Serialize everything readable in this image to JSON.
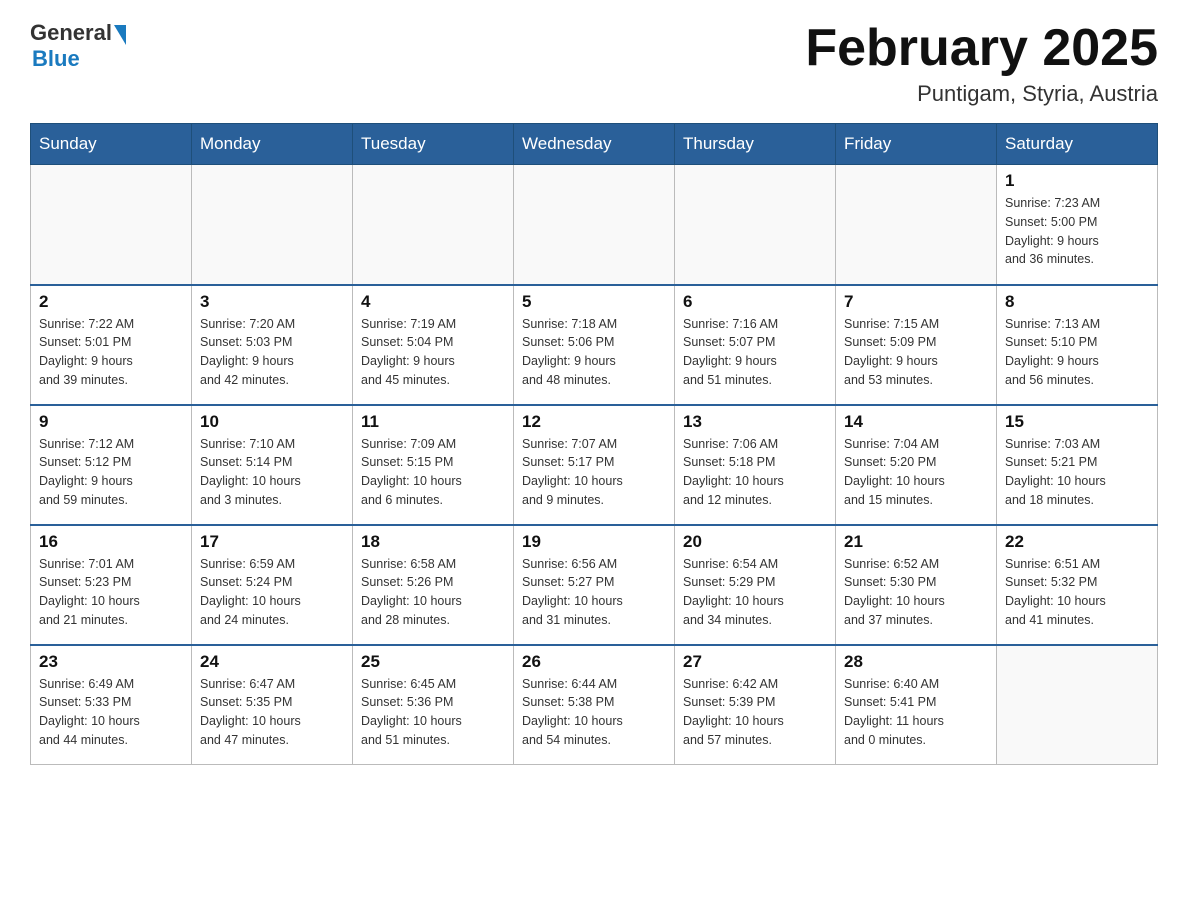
{
  "header": {
    "logo_general": "General",
    "logo_blue": "Blue",
    "month_title": "February 2025",
    "location": "Puntigam, Styria, Austria"
  },
  "days_of_week": [
    "Sunday",
    "Monday",
    "Tuesday",
    "Wednesday",
    "Thursday",
    "Friday",
    "Saturday"
  ],
  "weeks": [
    {
      "days": [
        {
          "date": "",
          "info": ""
        },
        {
          "date": "",
          "info": ""
        },
        {
          "date": "",
          "info": ""
        },
        {
          "date": "",
          "info": ""
        },
        {
          "date": "",
          "info": ""
        },
        {
          "date": "",
          "info": ""
        },
        {
          "date": "1",
          "info": "Sunrise: 7:23 AM\nSunset: 5:00 PM\nDaylight: 9 hours\nand 36 minutes."
        }
      ]
    },
    {
      "days": [
        {
          "date": "2",
          "info": "Sunrise: 7:22 AM\nSunset: 5:01 PM\nDaylight: 9 hours\nand 39 minutes."
        },
        {
          "date": "3",
          "info": "Sunrise: 7:20 AM\nSunset: 5:03 PM\nDaylight: 9 hours\nand 42 minutes."
        },
        {
          "date": "4",
          "info": "Sunrise: 7:19 AM\nSunset: 5:04 PM\nDaylight: 9 hours\nand 45 minutes."
        },
        {
          "date": "5",
          "info": "Sunrise: 7:18 AM\nSunset: 5:06 PM\nDaylight: 9 hours\nand 48 minutes."
        },
        {
          "date": "6",
          "info": "Sunrise: 7:16 AM\nSunset: 5:07 PM\nDaylight: 9 hours\nand 51 minutes."
        },
        {
          "date": "7",
          "info": "Sunrise: 7:15 AM\nSunset: 5:09 PM\nDaylight: 9 hours\nand 53 minutes."
        },
        {
          "date": "8",
          "info": "Sunrise: 7:13 AM\nSunset: 5:10 PM\nDaylight: 9 hours\nand 56 minutes."
        }
      ]
    },
    {
      "days": [
        {
          "date": "9",
          "info": "Sunrise: 7:12 AM\nSunset: 5:12 PM\nDaylight: 9 hours\nand 59 minutes."
        },
        {
          "date": "10",
          "info": "Sunrise: 7:10 AM\nSunset: 5:14 PM\nDaylight: 10 hours\nand 3 minutes."
        },
        {
          "date": "11",
          "info": "Sunrise: 7:09 AM\nSunset: 5:15 PM\nDaylight: 10 hours\nand 6 minutes."
        },
        {
          "date": "12",
          "info": "Sunrise: 7:07 AM\nSunset: 5:17 PM\nDaylight: 10 hours\nand 9 minutes."
        },
        {
          "date": "13",
          "info": "Sunrise: 7:06 AM\nSunset: 5:18 PM\nDaylight: 10 hours\nand 12 minutes."
        },
        {
          "date": "14",
          "info": "Sunrise: 7:04 AM\nSunset: 5:20 PM\nDaylight: 10 hours\nand 15 minutes."
        },
        {
          "date": "15",
          "info": "Sunrise: 7:03 AM\nSunset: 5:21 PM\nDaylight: 10 hours\nand 18 minutes."
        }
      ]
    },
    {
      "days": [
        {
          "date": "16",
          "info": "Sunrise: 7:01 AM\nSunset: 5:23 PM\nDaylight: 10 hours\nand 21 minutes."
        },
        {
          "date": "17",
          "info": "Sunrise: 6:59 AM\nSunset: 5:24 PM\nDaylight: 10 hours\nand 24 minutes."
        },
        {
          "date": "18",
          "info": "Sunrise: 6:58 AM\nSunset: 5:26 PM\nDaylight: 10 hours\nand 28 minutes."
        },
        {
          "date": "19",
          "info": "Sunrise: 6:56 AM\nSunset: 5:27 PM\nDaylight: 10 hours\nand 31 minutes."
        },
        {
          "date": "20",
          "info": "Sunrise: 6:54 AM\nSunset: 5:29 PM\nDaylight: 10 hours\nand 34 minutes."
        },
        {
          "date": "21",
          "info": "Sunrise: 6:52 AM\nSunset: 5:30 PM\nDaylight: 10 hours\nand 37 minutes."
        },
        {
          "date": "22",
          "info": "Sunrise: 6:51 AM\nSunset: 5:32 PM\nDaylight: 10 hours\nand 41 minutes."
        }
      ]
    },
    {
      "days": [
        {
          "date": "23",
          "info": "Sunrise: 6:49 AM\nSunset: 5:33 PM\nDaylight: 10 hours\nand 44 minutes."
        },
        {
          "date": "24",
          "info": "Sunrise: 6:47 AM\nSunset: 5:35 PM\nDaylight: 10 hours\nand 47 minutes."
        },
        {
          "date": "25",
          "info": "Sunrise: 6:45 AM\nSunset: 5:36 PM\nDaylight: 10 hours\nand 51 minutes."
        },
        {
          "date": "26",
          "info": "Sunrise: 6:44 AM\nSunset: 5:38 PM\nDaylight: 10 hours\nand 54 minutes."
        },
        {
          "date": "27",
          "info": "Sunrise: 6:42 AM\nSunset: 5:39 PM\nDaylight: 10 hours\nand 57 minutes."
        },
        {
          "date": "28",
          "info": "Sunrise: 6:40 AM\nSunset: 5:41 PM\nDaylight: 11 hours\nand 0 minutes."
        },
        {
          "date": "",
          "info": ""
        }
      ]
    }
  ]
}
